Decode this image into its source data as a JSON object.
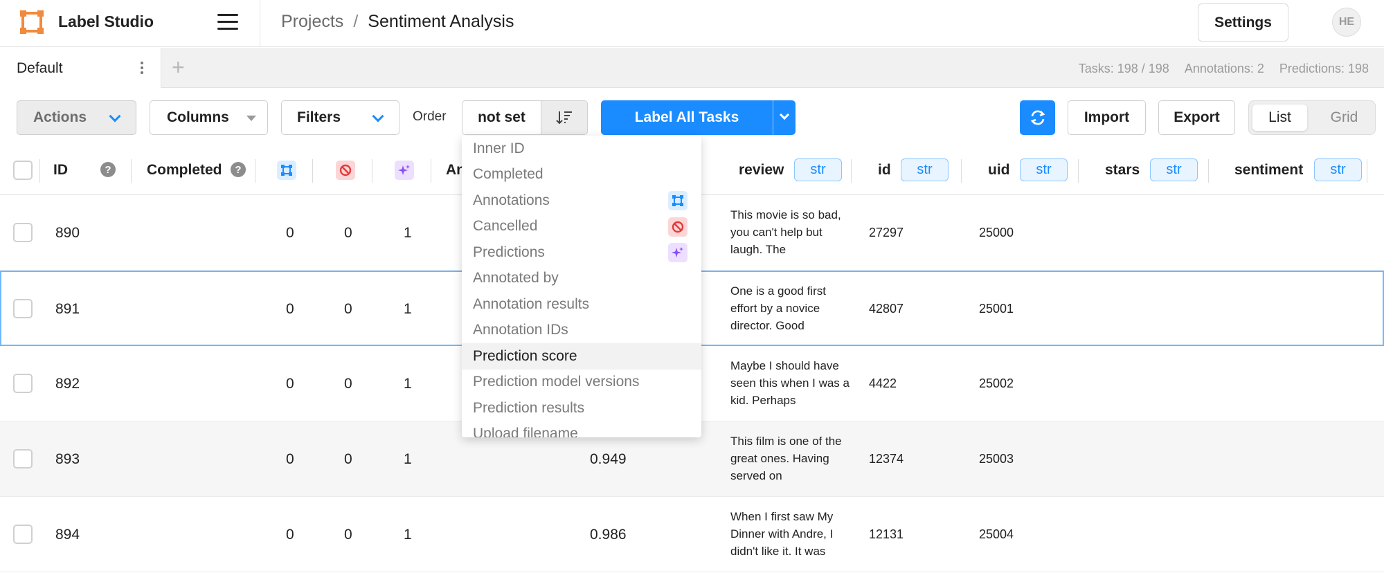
{
  "header": {
    "app_name": "Label Studio",
    "breadcrumb": {
      "root": "Projects",
      "separator": "/",
      "current": "Sentiment Analysis"
    },
    "settings_label": "Settings",
    "avatar_initials": "HE"
  },
  "tabs": {
    "items": [
      {
        "label": "Default"
      }
    ],
    "add_label": "+",
    "stats": {
      "tasks": "Tasks: 198 / 198",
      "annotations": "Annotations: 2",
      "predictions": "Predictions: 198"
    }
  },
  "toolbar": {
    "actions_label": "Actions",
    "columns_label": "Columns",
    "filters_label": "Filters",
    "order_label": "Order",
    "order_value": "not set",
    "label_all_label": "Label All Tasks",
    "import_label": "Import",
    "export_label": "Export",
    "view": {
      "list": "List",
      "grid": "Grid",
      "selected": "List"
    },
    "accent_color": "#1a8cff"
  },
  "order_dropdown": {
    "items": [
      {
        "label": "Inner ID",
        "icon": ""
      },
      {
        "label": "Completed",
        "icon": ""
      },
      {
        "label": "Annotations",
        "icon": "annotations-icon"
      },
      {
        "label": "Cancelled",
        "icon": "cancelled-icon"
      },
      {
        "label": "Predictions",
        "icon": "predictions-icon"
      },
      {
        "label": "Annotated by",
        "icon": ""
      },
      {
        "label": "Annotation results",
        "icon": ""
      },
      {
        "label": "Annotation IDs",
        "icon": ""
      },
      {
        "label": "Prediction score",
        "icon": "",
        "highlighted": true
      },
      {
        "label": "Prediction model versions",
        "icon": ""
      },
      {
        "label": "Prediction results",
        "icon": ""
      },
      {
        "label": "Upload filename",
        "icon": ""
      }
    ]
  },
  "table": {
    "columns": {
      "id": "ID",
      "completed": "Completed",
      "annotations_truncated": "An",
      "review": "review",
      "id_field": "id",
      "uid": "uid",
      "stars": "stars",
      "sentiment": "sentiment",
      "type_badge": "str"
    },
    "rows": [
      {
        "id": "890",
        "annotations": "0",
        "cancelled": "0",
        "predictions": "1",
        "score": "",
        "review": "This movie is so bad, you can't help but laugh. The",
        "id_field": "27297",
        "uid": "25000"
      },
      {
        "id": "891",
        "annotations": "0",
        "cancelled": "0",
        "predictions": "1",
        "score": "",
        "review": "One is a good first effort by a novice director. Good",
        "id_field": "42807",
        "uid": "25001"
      },
      {
        "id": "892",
        "annotations": "0",
        "cancelled": "0",
        "predictions": "1",
        "score": "",
        "review": "Maybe I should have seen this when I was a kid. Perhaps",
        "id_field": "4422",
        "uid": "25002"
      },
      {
        "id": "893",
        "annotations": "0",
        "cancelled": "0",
        "predictions": "1",
        "score": "0.949",
        "review": "This film is one of the great ones. Having served on",
        "id_field": "12374",
        "uid": "25003"
      },
      {
        "id": "894",
        "annotations": "0",
        "cancelled": "0",
        "predictions": "1",
        "score": "0.986",
        "review": "When I first saw My Dinner with Andre, I didn't like it. It was",
        "id_field": "12131",
        "uid": "25004"
      }
    ]
  }
}
